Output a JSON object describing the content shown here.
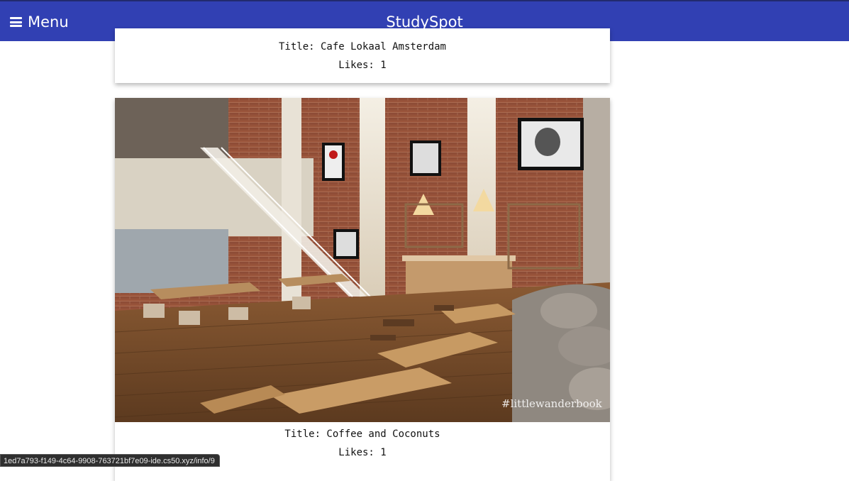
{
  "header": {
    "menu_label": "Menu",
    "brand": "StudySpot",
    "menu_icon": "hamburger-icon"
  },
  "posts": [
    {
      "title": "Title: Cafe Lokaal Amsterdam",
      "likes": "Likes: 1"
    },
    {
      "title": "Title: Coffee and Coconuts",
      "likes": "Likes: 1",
      "photo_watermark": "#littlewanderbook"
    }
  ],
  "status_url": "1ed7a793-f149-4c64-9908-763721bf7e09-ide.cs50.xyz/info/9",
  "colors": {
    "header_bg": "#3140b3",
    "header_text": "#ffffff"
  }
}
